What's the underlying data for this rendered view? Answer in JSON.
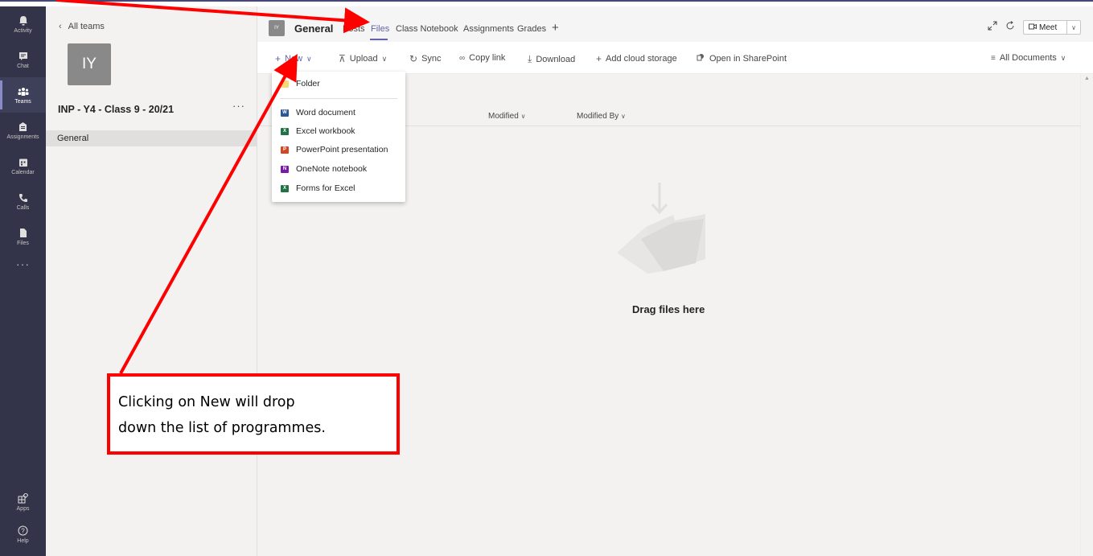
{
  "rail": {
    "items": [
      {
        "label": "Activity",
        "icon": "bell-icon"
      },
      {
        "label": "Chat",
        "icon": "chat-icon"
      },
      {
        "label": "Teams",
        "icon": "teams-icon"
      },
      {
        "label": "Assignments",
        "icon": "assignments-icon"
      },
      {
        "label": "Calendar",
        "icon": "calendar-icon"
      },
      {
        "label": "Calls",
        "icon": "phone-icon"
      },
      {
        "label": "Files",
        "icon": "files-icon"
      }
    ],
    "more": "···",
    "apps_label": "Apps",
    "help_label": "Help"
  },
  "team": {
    "back_label": "All teams",
    "avatar_initials": "IY",
    "name": "INP - Y4 - Class 9 - 20/21",
    "more": "···",
    "channel": "General"
  },
  "header": {
    "avatar_initials": "IY",
    "channel_title": "General",
    "tabs": [
      "Posts",
      "Files",
      "Class Notebook",
      "Assignments",
      "Grades"
    ],
    "active_tab": "Files",
    "add_tab": "+",
    "meet_label": "Meet"
  },
  "toolbar": {
    "new_label": "New",
    "upload_label": "Upload",
    "sync_label": "Sync",
    "copy_link_label": "Copy link",
    "download_label": "Download",
    "add_cloud_label": "Add cloud storage",
    "sharepoint_label": "Open in SharePoint",
    "view_label": "All Documents"
  },
  "columns": {
    "modified": "Modified",
    "modified_by": "Modified By"
  },
  "empty": {
    "text": "Drag files here"
  },
  "new_menu": {
    "items": [
      {
        "label": "Folder",
        "icon": "folder-icon",
        "color": "#f8d775"
      },
      {
        "label": "Word document",
        "icon": "word-icon",
        "color": "#2b579a"
      },
      {
        "label": "Excel workbook",
        "icon": "excel-icon",
        "color": "#217346"
      },
      {
        "label": "PowerPoint presentation",
        "icon": "powerpoint-icon",
        "color": "#d24726"
      },
      {
        "label": "OneNote notebook",
        "icon": "onenote-icon",
        "color": "#7719aa"
      },
      {
        "label": "Forms for Excel",
        "icon": "forms-icon",
        "color": "#217346"
      }
    ]
  },
  "annotation": {
    "line1": "Clicking on New will drop",
    "line2": "down the list of programmes.",
    "color": "#ff0000"
  },
  "colors": {
    "rail": "#33344a",
    "accent": "#6264a7"
  }
}
